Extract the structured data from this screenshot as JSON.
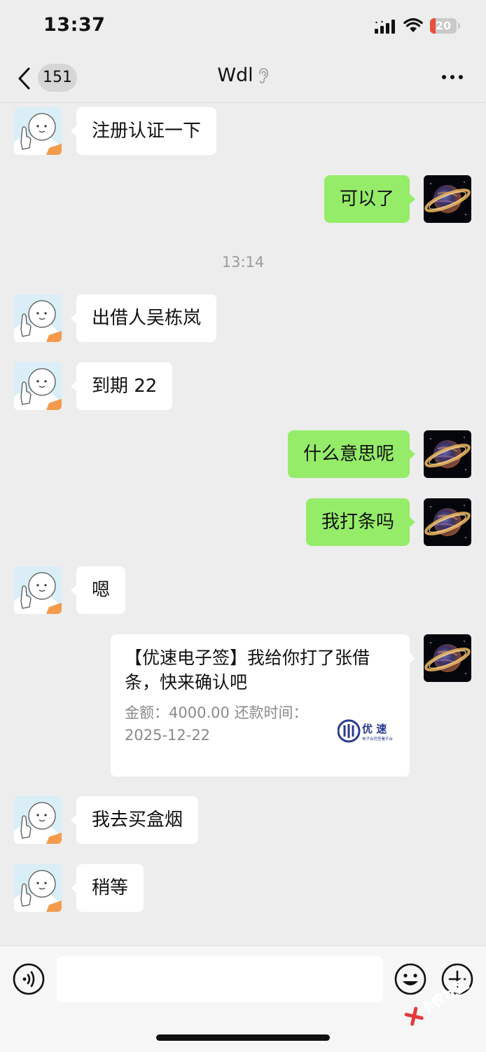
{
  "status_bar": {
    "time": "13:37",
    "battery": "20",
    "battery_level": 0.2
  },
  "header": {
    "back_badge": "151",
    "title": "Wdl"
  },
  "timestamp": "13:14",
  "messages": [
    {
      "side": "in",
      "text": "注册认证一下"
    },
    {
      "side": "out",
      "text": "可以了"
    },
    {
      "side": "in",
      "text": "出借人吴栋岚"
    },
    {
      "side": "in",
      "text": "到期 22"
    },
    {
      "side": "out",
      "text": "什么意思呢"
    },
    {
      "side": "out",
      "text": "我打条吗"
    },
    {
      "side": "in",
      "text": "嗯"
    },
    {
      "side": "in",
      "text": "我去买盒烟"
    },
    {
      "side": "in",
      "text": "稍等"
    }
  ],
  "card": {
    "title": "【优速电子签】我给你打了张借条，快来确认吧",
    "description": "金额：4000.00 还款时间：2025-12-22",
    "logo_text": "优速",
    "logo_subtext": "电子合同签署平台"
  },
  "input": {
    "placeholder": "",
    "value": ""
  },
  "watermark": "卡农社区",
  "icons": [
    "back-chevron-icon",
    "ear-icon",
    "more-icon",
    "voice-icon",
    "emoji-icon",
    "plus-icon",
    "signal-icon",
    "wifi-icon",
    "battery-icon"
  ]
}
